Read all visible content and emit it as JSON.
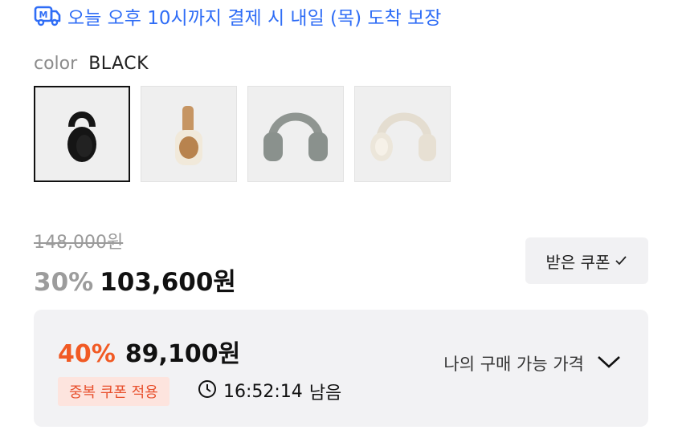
{
  "delivery": {
    "icon": "delivery-truck-icon",
    "text": "오늘 오후 10시까지 결제 시 내일 (목) 도착 보장",
    "color": "#2f6df6"
  },
  "color_option": {
    "label": "color",
    "value": "BLACK"
  },
  "swatches": [
    {
      "name": "black",
      "selected": true
    },
    {
      "name": "brown-beige",
      "selected": false
    },
    {
      "name": "gray",
      "selected": false
    },
    {
      "name": "cream",
      "selected": false
    }
  ],
  "pricing": {
    "original_price": "148,000원",
    "discount_percent": "30%",
    "sale_price": "103,600원",
    "coupon_button_label": "받은 쿠폰"
  },
  "best_price": {
    "percent": "40%",
    "price": "89,100원",
    "badge": "중복 쿠폰 적용",
    "timer": "16:52:14",
    "timer_suffix": "남음",
    "my_price_label": "나의 구매 가능 가격",
    "accent_color": "#f15a24"
  }
}
